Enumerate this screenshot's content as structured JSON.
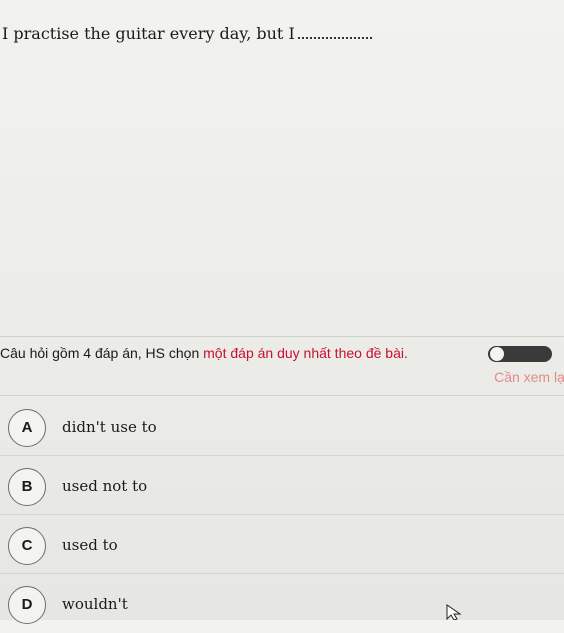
{
  "question": {
    "text": "I practise the guitar every day, but I"
  },
  "instruction": {
    "part1": "Câu hỏi gồm 4 đáp án, HS chọn ",
    "part2": "một đáp án duy nhất theo đề bài.",
    "review_link": "Cần xem lại"
  },
  "options": [
    {
      "letter": "A",
      "text": "didn't use to"
    },
    {
      "letter": "B",
      "text": "used not to"
    },
    {
      "letter": "C",
      "text": "used to"
    },
    {
      "letter": "D",
      "text": "wouldn't"
    }
  ],
  "colors": {
    "instruction_highlight": "#c8102e",
    "review_link": "#e38a8a"
  },
  "icons": {
    "toggle": "review-toggle",
    "cursor": "mouse-pointer-icon"
  }
}
